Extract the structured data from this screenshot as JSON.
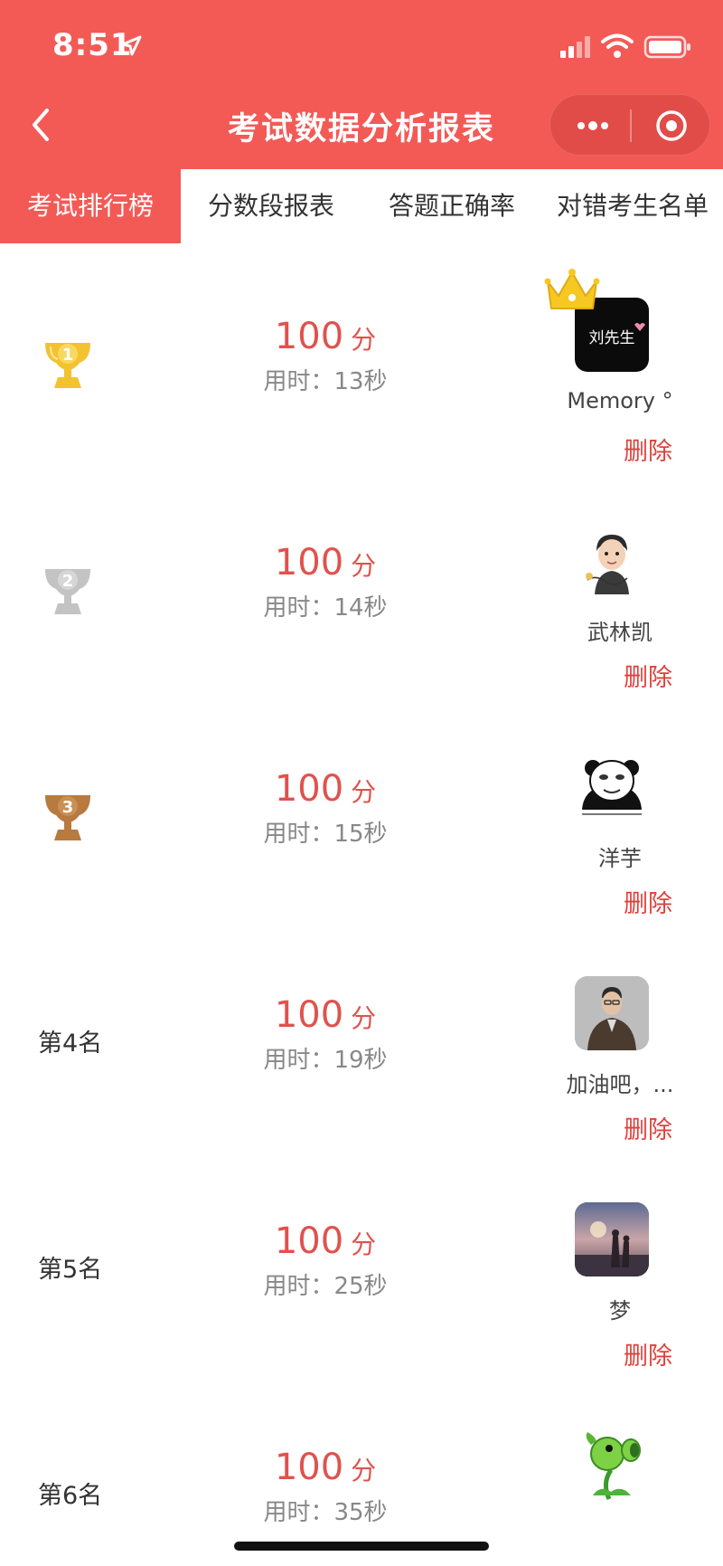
{
  "status_bar": {
    "time": "8:51"
  },
  "nav": {
    "title": "考试数据分析报表"
  },
  "tabs": [
    {
      "label": "考试排行榜",
      "active": true
    },
    {
      "label": "分数段报表",
      "active": false
    },
    {
      "label": "答题正确率",
      "active": false
    },
    {
      "label": "对错考生名单",
      "active": false
    }
  ],
  "colors": {
    "brand": "#f35a56",
    "score": "#e0524d",
    "delete": "#e0403c",
    "gold": "#f3c22f",
    "silver": "#c3c3c3",
    "bronze": "#b87a3f"
  },
  "ranking": {
    "score_unit": "分",
    "delete_label": "删除",
    "rows": [
      {
        "rank_icon": "gold-trophy-icon",
        "rank_number": "1",
        "score": "100",
        "time": "用时：13秒",
        "name": "Memory °",
        "avatar_text": "刘先生",
        "crown": true
      },
      {
        "rank_icon": "silver-trophy-icon",
        "rank_number": "2",
        "score": "100",
        "time": "用时：14秒",
        "name": "武林凯"
      },
      {
        "rank_icon": "bronze-trophy-icon",
        "rank_number": "3",
        "score": "100",
        "time": "用时：15秒",
        "name": "洋芋"
      },
      {
        "rank_label": "第4名",
        "score": "100",
        "time": "用时：19秒",
        "name": "加油吧，..."
      },
      {
        "rank_label": "第5名",
        "score": "100",
        "time": "用时：25秒",
        "name": "梦"
      },
      {
        "rank_label": "第6名",
        "score": "100",
        "time": "用时：35秒",
        "name": ""
      }
    ]
  }
}
